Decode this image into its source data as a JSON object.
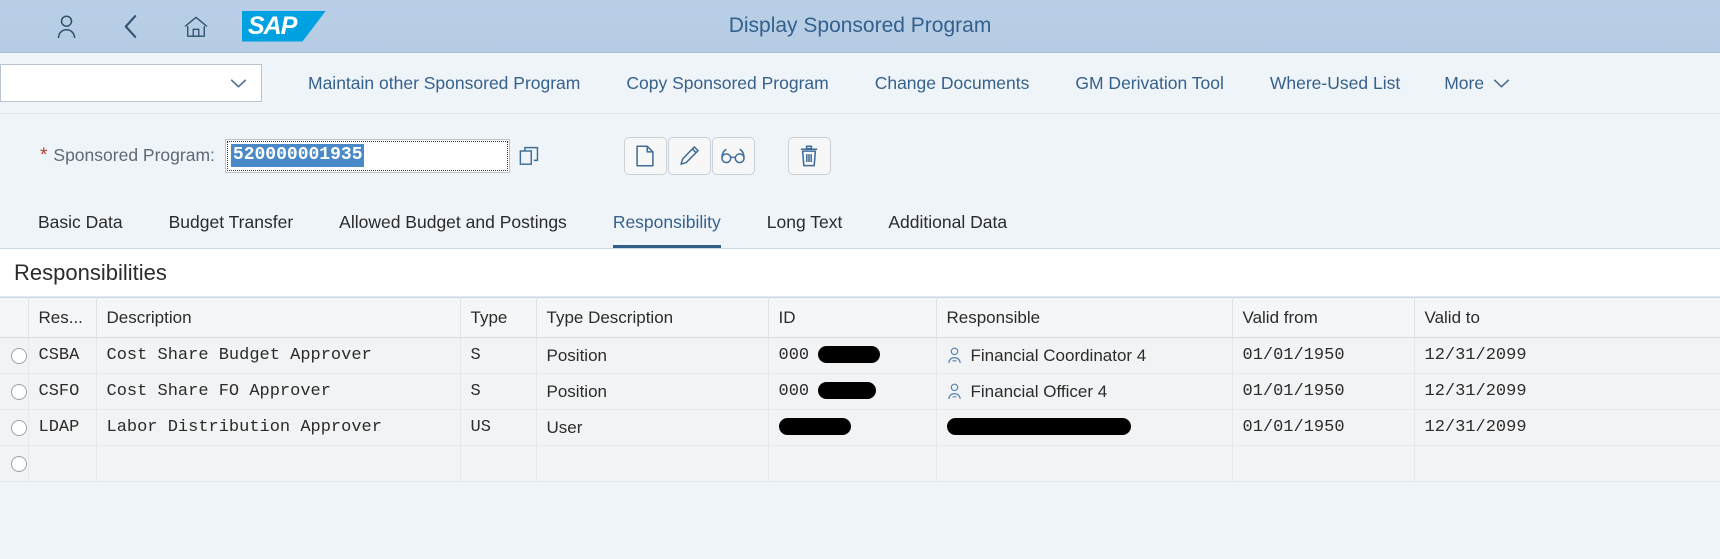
{
  "shell": {
    "title": "Display Sponsored Program",
    "icons": {
      "user": "user-icon",
      "back": "back-chevron-icon",
      "home": "home-icon",
      "logo": "sap-logo"
    },
    "logo_text": "SAP"
  },
  "toolbar": {
    "variant_value": "",
    "variant_placeholder": "",
    "links": [
      "Maintain other Sponsored Program",
      "Copy Sponsored Program",
      "Change Documents",
      "GM Derivation Tool",
      "Where-Used List"
    ],
    "more_label": "More"
  },
  "object": {
    "required_marker": "*",
    "label": "Sponsored Program:",
    "value": "520000001935",
    "value_selected": true,
    "value_help_icon": "value-help-icon",
    "buttons": [
      {
        "name": "create-button",
        "icon": "page-icon"
      },
      {
        "name": "edit-button",
        "icon": "pencil-icon"
      },
      {
        "name": "display-button",
        "icon": "glasses-icon"
      },
      {
        "name": "delete-button",
        "icon": "trash-icon"
      }
    ]
  },
  "tabs": {
    "items": [
      "Basic Data",
      "Budget Transfer",
      "Allowed Budget and Postings",
      "Responsibility",
      "Long Text",
      "Additional Data"
    ],
    "active": "Responsibility"
  },
  "section": {
    "title": "Responsibilities"
  },
  "table": {
    "columns": [
      "",
      "Res...",
      "Description",
      "Type",
      "Type Description",
      "ID",
      "Responsible",
      "Valid from",
      "Valid to"
    ],
    "rows": [
      {
        "res": "CSBA",
        "description": "Cost Share Budget Approver",
        "type": "S",
        "type_description": "Position",
        "id_prefix": "000",
        "id_redacted_width": 62,
        "responsible": "Financial Coordinator 4",
        "responsible_redacted_width": 0,
        "valid_from": "01/01/1950",
        "valid_to": "12/31/2099"
      },
      {
        "res": "CSFO",
        "description": "Cost Share FO Approver",
        "type": "S",
        "type_description": "Position",
        "id_prefix": "000",
        "id_redacted_width": 58,
        "responsible": "Financial Officer 4",
        "responsible_redacted_width": 0,
        "valid_from": "01/01/1950",
        "valid_to": "12/31/2099"
      },
      {
        "res": "LDAP",
        "description": "Labor Distribution Approver",
        "type": "US",
        "type_description": "User",
        "id_prefix": "",
        "id_redacted_width": 72,
        "responsible": "",
        "responsible_redacted_width": 184,
        "valid_from": "01/01/1950",
        "valid_to": "12/31/2099"
      },
      {
        "res": "",
        "description": "",
        "type": "",
        "type_description": "",
        "id_prefix": "",
        "id_redacted_width": 0,
        "responsible": "",
        "responsible_redacted_width": 0,
        "valid_from": "",
        "valid_to": ""
      }
    ]
  },
  "colors": {
    "shell_bg": "#b7cde5",
    "accent": "#36618d",
    "page_bg": "#eff4f9",
    "table_row_bg": "#f2f3f4",
    "selection_blue": "#4a89c8",
    "required_red": "#c0392b",
    "sap_blue": "#00a1e0"
  }
}
